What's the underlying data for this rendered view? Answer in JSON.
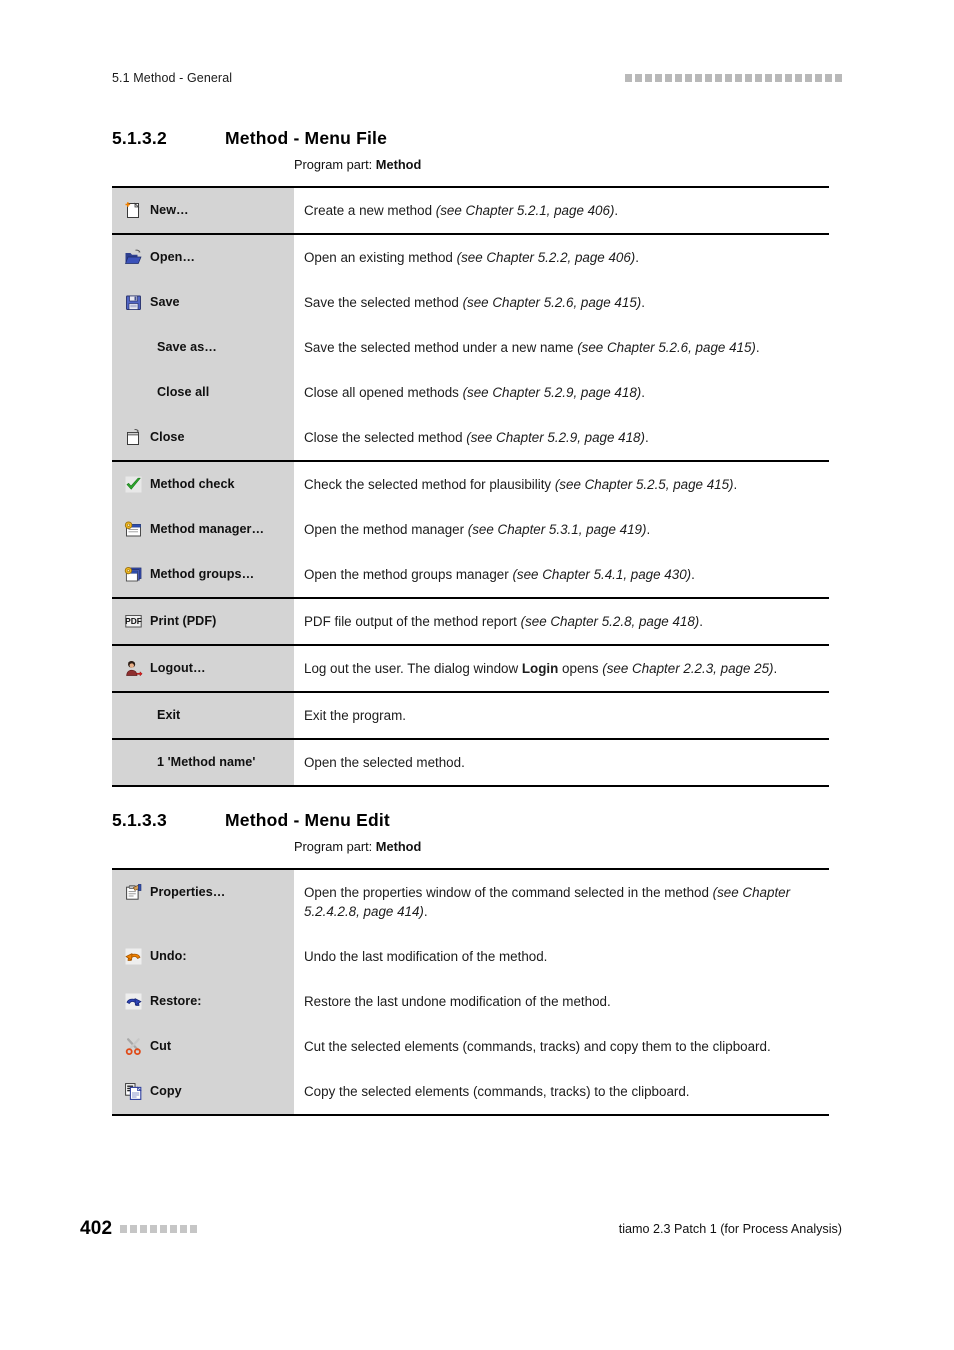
{
  "header": {
    "running_title": "5.1 Method - General",
    "decoration_squares": 22
  },
  "footer": {
    "page_number": "402",
    "decoration_squares": 8,
    "product": "tiamo 2.3 Patch 1 (for Process Analysis)"
  },
  "sections": [
    {
      "number": "5.1.3.2",
      "title": "Method - Menu File",
      "program_part_label": "Program part: ",
      "program_part_value": "Method",
      "rows": [
        {
          "icon": "new-document-icon",
          "label": "New…",
          "indent": false,
          "group_start": true,
          "desc_plain": "Create a new method ",
          "desc_italic": "(see Chapter 5.2.1, page 406)",
          "desc_tail": "."
        },
        {
          "icon": "open-folder-icon",
          "label": "Open…",
          "indent": false,
          "group_start": true,
          "desc_plain": "Open an existing method ",
          "desc_italic": "(see Chapter 5.2.2, page 406)",
          "desc_tail": "."
        },
        {
          "icon": "save-floppy-icon",
          "label": "Save",
          "indent": false,
          "group_start": false,
          "desc_plain": "Save the selected method ",
          "desc_italic": "(see Chapter 5.2.6, page 415)",
          "desc_tail": "."
        },
        {
          "icon": null,
          "label": "Save as…",
          "indent": true,
          "group_start": false,
          "desc_plain": "Save the selected method under a new name ",
          "desc_italic": "(see Chapter 5.2.6, page 415)",
          "desc_tail": "."
        },
        {
          "icon": null,
          "label": "Close all",
          "indent": true,
          "group_start": false,
          "desc_plain": "Close all opened methods ",
          "desc_italic": "(see Chapter 5.2.9, page 418)",
          "desc_tail": "."
        },
        {
          "icon": "close-document-icon",
          "label": "Close",
          "indent": false,
          "group_start": false,
          "desc_plain": "Close the selected method ",
          "desc_italic": "(see Chapter 5.2.9, page 418)",
          "desc_tail": "."
        },
        {
          "icon": "check-mark-icon",
          "label": "Method check",
          "indent": false,
          "group_start": true,
          "desc_plain": "Check the selected method for plausibility ",
          "desc_italic": "(see Chapter 5.2.5, page 415)",
          "desc_tail": "."
        },
        {
          "icon": "method-manager-icon",
          "label": "Method manager…",
          "indent": false,
          "group_start": false,
          "desc_plain": "Open the method manager ",
          "desc_italic": "(see Chapter 5.3.1, page 419)",
          "desc_tail": "."
        },
        {
          "icon": "method-groups-icon",
          "label": "Method groups…",
          "indent": false,
          "group_start": false,
          "desc_plain": "Open the method groups manager ",
          "desc_italic": "(see Chapter 5.4.1, page 430)",
          "desc_tail": "."
        },
        {
          "icon": "pdf-icon",
          "label": "Print (PDF)",
          "indent": false,
          "group_start": true,
          "desc_plain": "PDF file output of the method report ",
          "desc_italic": "(see Chapter 5.2.8, page 418)",
          "desc_tail": "."
        },
        {
          "icon": "logout-user-icon",
          "label": "Logout…",
          "indent": false,
          "group_start": true,
          "desc_plain": "Log out the user. The dialog window ",
          "desc_bold": "Login",
          "desc_plain2": " opens ",
          "desc_italic": "(see Chapter 2.2.3, page 25)",
          "desc_tail": "."
        },
        {
          "icon": null,
          "label": "Exit",
          "indent": true,
          "group_start": true,
          "desc_plain": "Exit the program.",
          "desc_italic": "",
          "desc_tail": ""
        },
        {
          "icon": null,
          "label": "1 'Method name'",
          "indent": true,
          "group_start": true,
          "desc_plain": "Open the selected method.",
          "desc_italic": "",
          "desc_tail": ""
        }
      ]
    },
    {
      "number": "5.1.3.3",
      "title": "Method - Menu Edit",
      "program_part_label": "Program part: ",
      "program_part_value": "Method",
      "rows": [
        {
          "icon": "properties-icon",
          "label": "Properties…",
          "indent": false,
          "group_start": true,
          "desc_plain": "Open the properties window of the command selected in the method ",
          "desc_italic": "(see Chapter 5.2.4.2.8, page 414)",
          "desc_tail": "."
        },
        {
          "icon": "undo-icon",
          "label": "Undo:",
          "indent": false,
          "group_start": false,
          "desc_plain": "Undo the last modification of the method.",
          "desc_italic": "",
          "desc_tail": ""
        },
        {
          "icon": "redo-restore-icon",
          "label": "Restore:",
          "indent": false,
          "group_start": false,
          "desc_plain": "Restore the last undone modification of the method.",
          "desc_italic": "",
          "desc_tail": ""
        },
        {
          "icon": "scissors-cut-icon",
          "label": "Cut",
          "indent": false,
          "group_start": false,
          "desc_plain": "Cut the selected elements (commands, tracks) and copy them to the clipboard.",
          "desc_italic": "",
          "desc_tail": ""
        },
        {
          "icon": "copy-icon",
          "label": "Copy",
          "indent": false,
          "group_start": false,
          "desc_plain": "Copy the selected elements (commands, tracks) to the clipboard.",
          "desc_italic": "",
          "desc_tail": ""
        }
      ]
    }
  ],
  "colors": {
    "command_cell_bg": "#d4d4d4",
    "rule": "#000000",
    "decoration_square": "#c6c6c6"
  }
}
